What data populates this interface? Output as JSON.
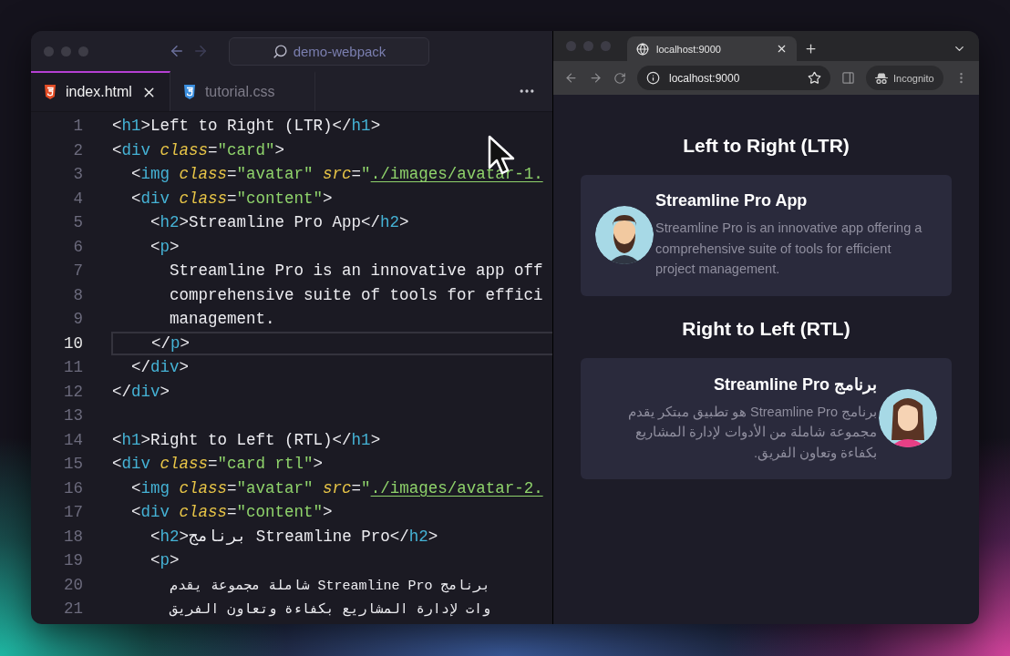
{
  "editor": {
    "search": "demo-webpack",
    "tabs": [
      {
        "label": "index.html",
        "kind": "html",
        "selected": true
      },
      {
        "label": "tutorial.css",
        "kind": "css",
        "selected": false
      }
    ],
    "lines": [
      {
        "number": "1",
        "current": false,
        "tokens": [
          {
            "kind": "punct",
            "text": "<"
          },
          {
            "kind": "tag",
            "text": "h1"
          },
          {
            "kind": "punct",
            "text": ">"
          },
          {
            "kind": "text",
            "text": "Left to Right (LTR)"
          },
          {
            "kind": "punct",
            "text": "</"
          },
          {
            "kind": "tag",
            "text": "h1"
          },
          {
            "kind": "punct",
            "text": ">"
          }
        ]
      },
      {
        "number": "2",
        "current": false,
        "tokens": [
          {
            "kind": "punct",
            "text": "<"
          },
          {
            "kind": "tag",
            "text": "div"
          },
          {
            "kind": "attr",
            "text": " class"
          },
          {
            "kind": "punct",
            "text": "="
          },
          {
            "kind": "str",
            "text": "\"card\""
          },
          {
            "kind": "punct",
            "text": ">"
          }
        ]
      },
      {
        "number": "3",
        "current": false,
        "tokens": [
          {
            "kind": "punct",
            "text": "  <"
          },
          {
            "kind": "tag",
            "text": "img"
          },
          {
            "kind": "attr",
            "text": " class"
          },
          {
            "kind": "punct",
            "text": "="
          },
          {
            "kind": "str",
            "text": "\"avatar\""
          },
          {
            "kind": "attr",
            "text": " src"
          },
          {
            "kind": "punct",
            "text": "="
          },
          {
            "kind": "str",
            "text": "\""
          },
          {
            "kind": "link",
            "text": "./images/avatar-1."
          }
        ]
      },
      {
        "number": "4",
        "current": false,
        "tokens": [
          {
            "kind": "punct",
            "text": "  <"
          },
          {
            "kind": "tag",
            "text": "div"
          },
          {
            "kind": "attr",
            "text": " class"
          },
          {
            "kind": "punct",
            "text": "="
          },
          {
            "kind": "str",
            "text": "\"content\""
          },
          {
            "kind": "punct",
            "text": ">"
          }
        ]
      },
      {
        "number": "5",
        "current": false,
        "tokens": [
          {
            "kind": "punct",
            "text": "    <"
          },
          {
            "kind": "tag",
            "text": "h2"
          },
          {
            "kind": "punct",
            "text": ">"
          },
          {
            "kind": "text",
            "text": "Streamline Pro App"
          },
          {
            "kind": "punct",
            "text": "</"
          },
          {
            "kind": "tag",
            "text": "h2"
          },
          {
            "kind": "punct",
            "text": ">"
          }
        ]
      },
      {
        "number": "6",
        "current": false,
        "tokens": [
          {
            "kind": "punct",
            "text": "    <"
          },
          {
            "kind": "tag",
            "text": "p"
          },
          {
            "kind": "punct",
            "text": ">"
          }
        ]
      },
      {
        "number": "7",
        "current": false,
        "tokens": [
          {
            "kind": "text",
            "text": "      Streamline Pro is an innovative app off"
          }
        ]
      },
      {
        "number": "8",
        "current": false,
        "tokens": [
          {
            "kind": "text",
            "text": "      comprehensive suite of tools for effici"
          }
        ]
      },
      {
        "number": "9",
        "current": false,
        "tokens": [
          {
            "kind": "text",
            "text": "      management."
          }
        ]
      },
      {
        "number": "10",
        "current": true,
        "tokens": [
          {
            "kind": "punct",
            "text": "    </"
          },
          {
            "kind": "tag",
            "text": "p"
          },
          {
            "kind": "punct",
            "text": ">"
          }
        ]
      },
      {
        "number": "11",
        "current": false,
        "tokens": [
          {
            "kind": "punct",
            "text": "  </"
          },
          {
            "kind": "tag",
            "text": "div"
          },
          {
            "kind": "punct",
            "text": ">"
          }
        ]
      },
      {
        "number": "12",
        "current": false,
        "tokens": [
          {
            "kind": "punct",
            "text": "</"
          },
          {
            "kind": "tag",
            "text": "div"
          },
          {
            "kind": "punct",
            "text": ">"
          }
        ]
      },
      {
        "number": "13",
        "current": false
      },
      {
        "number": "14",
        "current": false,
        "tokens": [
          {
            "kind": "punct",
            "text": "<"
          },
          {
            "kind": "tag",
            "text": "h1"
          },
          {
            "kind": "punct",
            "text": ">"
          },
          {
            "kind": "text",
            "text": "Right to Left (RTL)"
          },
          {
            "kind": "punct",
            "text": "</"
          },
          {
            "kind": "tag",
            "text": "h1"
          },
          {
            "kind": "punct",
            "text": ">"
          }
        ]
      },
      {
        "number": "15",
        "current": false,
        "tokens": [
          {
            "kind": "punct",
            "text": "<"
          },
          {
            "kind": "tag",
            "text": "div"
          },
          {
            "kind": "attr",
            "text": " class"
          },
          {
            "kind": "punct",
            "text": "="
          },
          {
            "kind": "str",
            "text": "\"card rtl\""
          },
          {
            "kind": "punct",
            "text": ">"
          }
        ]
      },
      {
        "number": "16",
        "current": false,
        "tokens": [
          {
            "kind": "punct",
            "text": "  <"
          },
          {
            "kind": "tag",
            "text": "img"
          },
          {
            "kind": "attr",
            "text": " class"
          },
          {
            "kind": "punct",
            "text": "="
          },
          {
            "kind": "str",
            "text": "\"avatar\""
          },
          {
            "kind": "attr",
            "text": " src"
          },
          {
            "kind": "punct",
            "text": "="
          },
          {
            "kind": "str",
            "text": "\""
          },
          {
            "kind": "link",
            "text": "./images/avatar-2."
          }
        ]
      },
      {
        "number": "17",
        "current": false,
        "tokens": [
          {
            "kind": "punct",
            "text": "  <"
          },
          {
            "kind": "tag",
            "text": "div"
          },
          {
            "kind": "attr",
            "text": " class"
          },
          {
            "kind": "punct",
            "text": "="
          },
          {
            "kind": "str",
            "text": "\"content\""
          },
          {
            "kind": "punct",
            "text": ">"
          }
        ]
      },
      {
        "number": "18",
        "current": false,
        "tokens": [
          {
            "kind": "punct",
            "text": "    <"
          },
          {
            "kind": "tag",
            "text": "h2"
          },
          {
            "kind": "punct",
            "text": ">"
          },
          {
            "kind": "text",
            "text": "برنامج Streamline Pro"
          },
          {
            "kind": "punct",
            "text": "</"
          },
          {
            "kind": "tag",
            "text": "h2"
          },
          {
            "kind": "punct",
            "text": ">"
          }
        ]
      },
      {
        "number": "19",
        "current": false,
        "tokens": [
          {
            "kind": "punct",
            "text": "    <"
          },
          {
            "kind": "tag",
            "text": "p"
          },
          {
            "kind": "punct",
            "text": ">"
          }
        ]
      },
      {
        "number": "20",
        "current": false,
        "tokens": [
          {
            "kind": "rtl",
            "text": "برنامج Streamline Pro شاملة مجموعة يقدم"
          }
        ]
      },
      {
        "number": "21",
        "current": false,
        "tokens": [
          {
            "kind": "rtl",
            "text": "وات لإدارة المشاريع بكفاءة وتعاون الفريق"
          }
        ]
      }
    ]
  },
  "browser": {
    "tab": {
      "title": "localhost:9000"
    },
    "address": "localhost:9000",
    "incognito": "Incognito",
    "sections": [
      {
        "heading": "Left to Right (LTR)",
        "card": {
          "kind": "ltr",
          "avatar": {
            "kind": "bearded"
          },
          "title": "Streamline Pro App",
          "text": "Streamline Pro is an innovative app offering a comprehensive suite of tools for efficient project management."
        }
      },
      {
        "heading": "Right to Left (RTL)",
        "card": {
          "kind": "rtl",
          "avatar": {
            "kind": "long-hair"
          },
          "title": "برنامج Streamline Pro",
          "text": "برنامج Streamline Pro هو تطبيق مبتكر يقدم مجموعة شاملة من الأدوات لإدارة المشاريع بكفاءة وتعاون الفريق."
        }
      }
    ]
  }
}
